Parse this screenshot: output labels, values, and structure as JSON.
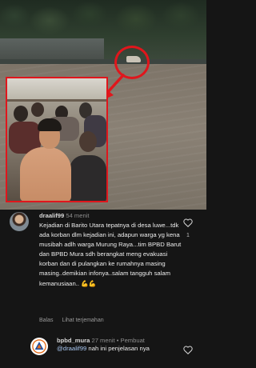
{
  "video": {
    "accent": "#e0161c"
  },
  "comments": [
    {
      "username": "draalif99",
      "time": "54 menit",
      "text": "Kejadian di Barito Utara tepatnya di desa luwe...tdk ada  korban dlm kejadian ini, adapun warga yg kena musibah adlh warga Murung Raya...tim BPBD Barut dan BPBD Mura sdh berangkat meng evakuasi korban dan di pulangkan ke rumahnya masing masing..demikian infonya..salam tangguh salam kemanusiaan.. 💪💪",
      "likes": "1",
      "reply_label": "Balas",
      "translate_label": "Lihat terjemahan",
      "icon": "heart-outline"
    },
    {
      "username": "bpbd_mura",
      "time": "27 menit",
      "badge": "• Pembuat",
      "mention": "@draalif99",
      "text": " nah ini penjelasan nya",
      "icon": "heart-outline"
    }
  ]
}
